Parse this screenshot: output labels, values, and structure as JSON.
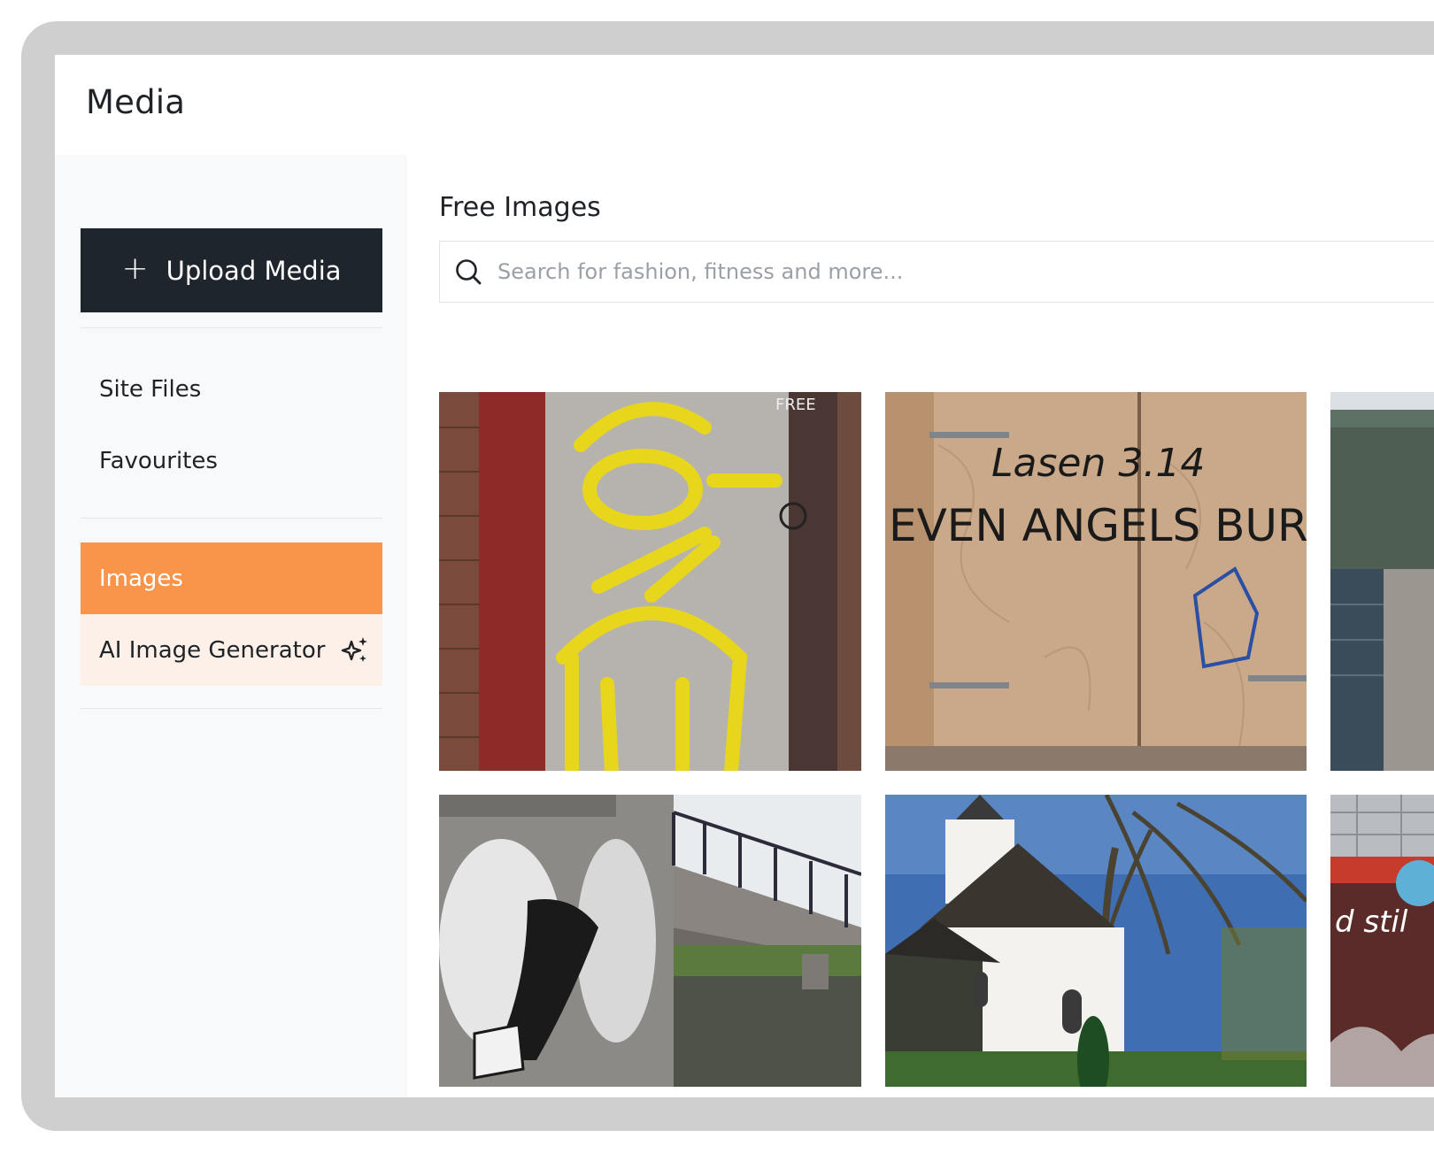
{
  "app": {
    "title": "Media"
  },
  "sidebar": {
    "upload_label": "Upload Media",
    "upload_icon": "plus-icon",
    "library_items": [
      {
        "label": "Site Files"
      },
      {
        "label": "Favourites"
      }
    ],
    "media_items": [
      {
        "label": "Images",
        "active": true
      },
      {
        "label": "AI Image Generator",
        "icon": "sparkle-icon"
      }
    ]
  },
  "main": {
    "section_title": "Free Images",
    "search": {
      "placeholder": "Search for fashion, fitness and more...",
      "icon": "search-icon",
      "value": ""
    },
    "images": [
      {
        "subject": "yellow graffiti face on wall",
        "graffiti_text": "FREE"
      },
      {
        "subject": "plywood door with graffiti",
        "graffiti_text": "EVEN ANGELS BURN",
        "tag": "Lasen 3.14"
      },
      {
        "subject": "bridge over canal"
      },
      {
        "subject": "graffiti mural by canal bridge"
      },
      {
        "subject": "white church with trees"
      },
      {
        "subject": "graffiti wall under building",
        "graffiti_text": "d stil"
      }
    ]
  },
  "colors": {
    "accent": "#f9954b",
    "accent_soft": "#fcf0e8",
    "button_dark": "#1e252c",
    "sidebar_bg": "#f8f9fb",
    "frame": "#cfcfcf"
  }
}
